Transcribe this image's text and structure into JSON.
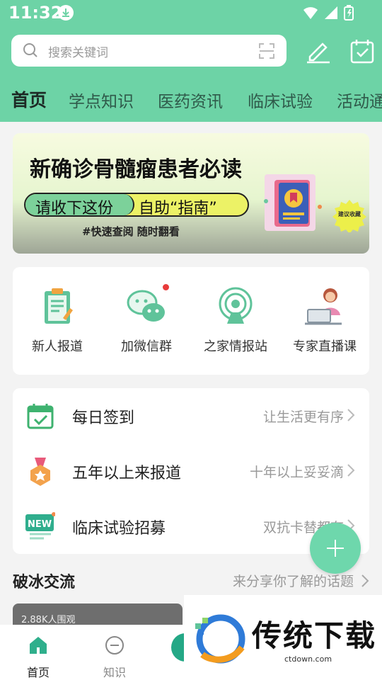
{
  "status_bar": {
    "time": "11:32"
  },
  "search": {
    "placeholder": "搜索关键词"
  },
  "tabs": [
    "首页",
    "学点知识",
    "医药资讯",
    "临床试验",
    "活动通"
  ],
  "banner": {
    "title": "新确诊骨髓瘤患者必读",
    "pill_left": "请收下这份",
    "pill_right": "自助“指南”",
    "subtitle": "#快速查阅 随时翻看",
    "seal": "建议收藏"
  },
  "quick_actions": [
    {
      "label": "新人报道",
      "icon": "clipboard-icon"
    },
    {
      "label": "加微信群",
      "icon": "wechat-icon",
      "badge": true
    },
    {
      "label": "之家情报站",
      "icon": "broadcast-icon"
    },
    {
      "label": "专家直播课",
      "icon": "expert-laptop-icon"
    }
  ],
  "list_rows": [
    {
      "title": "每日签到",
      "hint": "让生活更有序",
      "icon": "calendar-check-icon"
    },
    {
      "title": "五年以上来报道",
      "hint": "十年以上妥妥滴",
      "icon": "medal-icon"
    },
    {
      "title": "临床试验招募",
      "hint": "双抗卡替都有",
      "icon": "new-badge-icon"
    }
  ],
  "icebreak": {
    "title": "破冰交流",
    "more": "来分享你了解的话题"
  },
  "card_preview": {
    "views": "2.88K人围观"
  },
  "bottom_nav": [
    {
      "label": "首页",
      "icon": "home-icon",
      "active": true
    },
    {
      "label": "知识",
      "icon": "knowledge-icon",
      "active": false
    }
  ],
  "watermark": {
    "brand": "传统下载",
    "url": "ctdown.com"
  },
  "colors": {
    "theme": "#6dd3a6",
    "accent_dark": "#24a886",
    "badge_red": "#e83b3b"
  }
}
